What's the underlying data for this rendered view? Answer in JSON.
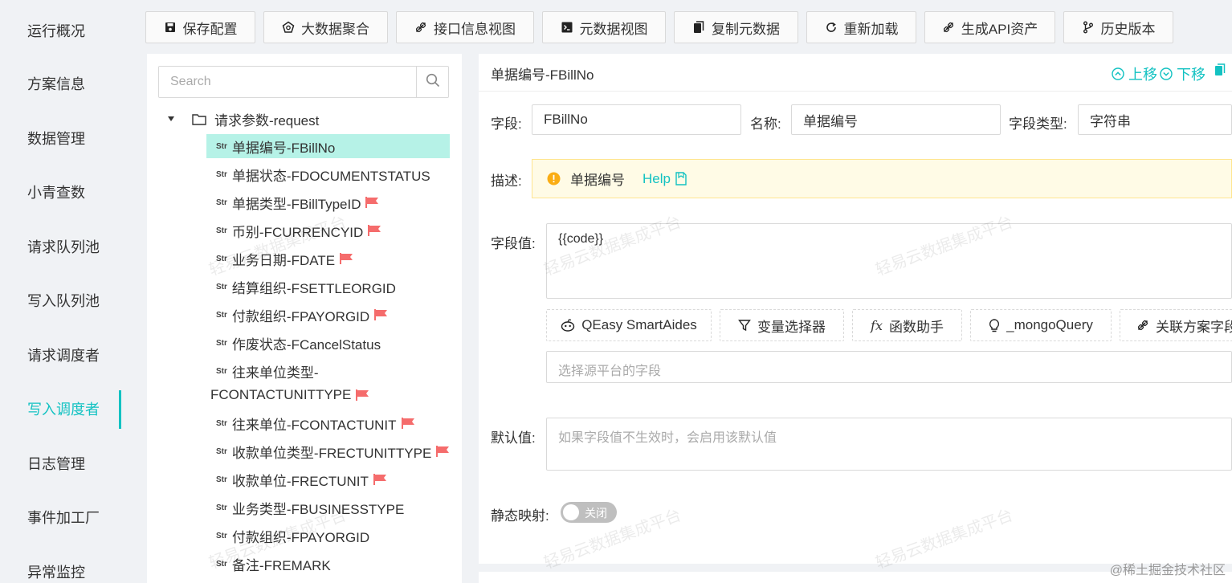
{
  "sidebar": {
    "items": [
      {
        "label": "运行概况"
      },
      {
        "label": "方案信息"
      },
      {
        "label": "数据管理"
      },
      {
        "label": "小青查数"
      },
      {
        "label": "请求队列池"
      },
      {
        "label": "写入队列池"
      },
      {
        "label": "请求调度者"
      },
      {
        "label": "写入调度者"
      },
      {
        "label": "日志管理"
      },
      {
        "label": "事件加工厂"
      },
      {
        "label": "异常监控"
      }
    ],
    "active_index": 7,
    "accent": "#13c2c2"
  },
  "toolbar": {
    "buttons": [
      {
        "label": "保存配置",
        "icon": "save-icon"
      },
      {
        "label": "大数据聚合",
        "icon": "aggregate-icon"
      },
      {
        "label": "接口信息视图",
        "icon": "api-link-icon"
      },
      {
        "label": "元数据视图",
        "icon": "terminal-icon"
      },
      {
        "label": "复制元数据",
        "icon": "copy-icon"
      },
      {
        "label": "重新加载",
        "icon": "reload-icon"
      },
      {
        "label": "生成API资产",
        "icon": "api-link-icon"
      },
      {
        "label": "历史版本",
        "icon": "branch-icon"
      }
    ]
  },
  "tree": {
    "search_placeholder": "Search",
    "root_label": "请求参数-request",
    "str_tag": "Str",
    "nodes": [
      {
        "label": "单据编号-FBillNo",
        "flag": false,
        "selected": true
      },
      {
        "label": "单据状态-FDOCUMENTSTATUS",
        "flag": false
      },
      {
        "label": "单据类型-FBillTypeID",
        "flag": true
      },
      {
        "label": "币别-FCURRENCYID",
        "flag": true
      },
      {
        "label": "业务日期-FDATE",
        "flag": true
      },
      {
        "label": "结算组织-FSETTLEORGID",
        "flag": false
      },
      {
        "label": "付款组织-FPAYORGID",
        "flag": true
      },
      {
        "label": "作废状态-FCancelStatus",
        "flag": false
      },
      {
        "label": "往来单位类型-",
        "label2": "FCONTACTUNITTYPE",
        "flag": true
      },
      {
        "label": "往来单位-FCONTACTUNIT",
        "flag": true
      },
      {
        "label": "收款单位类型-FRECTUNITTYPE",
        "flag": true
      },
      {
        "label": "收款单位-FRECTUNIT",
        "flag": true
      },
      {
        "label": "业务类型-FBUSINESSTYPE",
        "flag": false
      },
      {
        "label": "付款组织-FPAYORGID",
        "flag": false
      },
      {
        "label": "备注-FREMARK",
        "flag": false
      }
    ],
    "flag_color": "#f56c6c"
  },
  "detail": {
    "title": "单据编号-FBillNo",
    "move_up": "上移",
    "move_down": "下移",
    "field_label": "字段:",
    "field_value": "FBillNo",
    "name_label": "名称:",
    "name_value": "单据编号",
    "type_label": "字段类型:",
    "type_value": "字符串",
    "desc_label": "描述:",
    "desc_text": "单据编号",
    "help_text": "Help",
    "value_label": "字段值:",
    "value_text": "{{code}}",
    "tools": [
      {
        "label": "QEasy SmartAides",
        "icon": "robot-icon"
      },
      {
        "label": "变量选择器",
        "icon": "filter-icon"
      },
      {
        "label": "函数助手",
        "icon": "function-icon"
      },
      {
        "label": "_mongoQuery",
        "icon": "bulb-icon"
      },
      {
        "label": "关联方案字段",
        "icon": "api-link-icon"
      }
    ],
    "source_placeholder": "选择源平台的字段",
    "default_label": "默认值:",
    "default_placeholder": "如果字段值不生效时，会启用该默认值",
    "static_label": "静态映射:",
    "toggle_text": "关闭"
  },
  "watermark_text": "轻易云数据集成平台",
  "footer_text": "@稀土掘金技术社区"
}
